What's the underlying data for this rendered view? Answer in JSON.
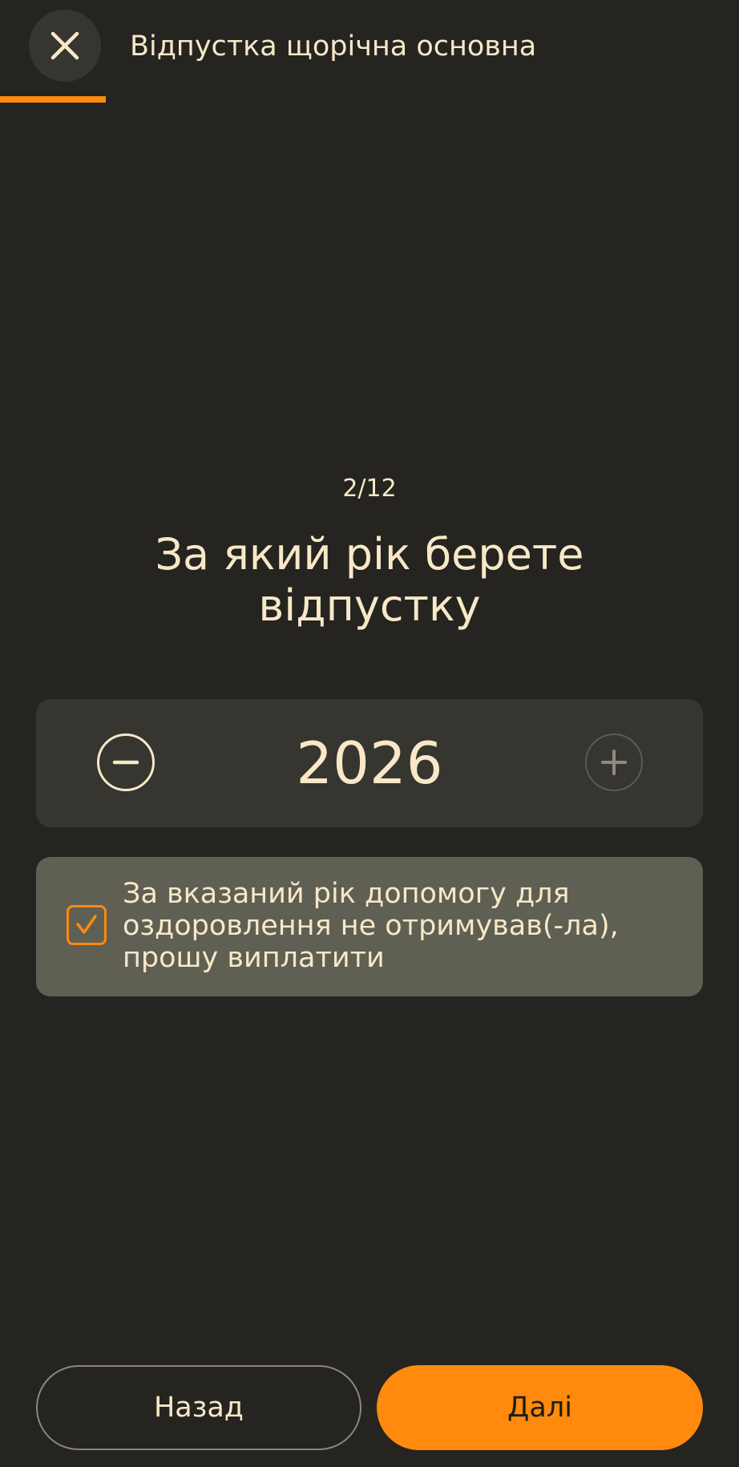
{
  "header": {
    "title": "Відпустка щорічна основна",
    "close_icon": "close-icon"
  },
  "progress": {
    "current": 2,
    "total": 12,
    "fraction": 0.1429,
    "color": "#FF8A0D"
  },
  "step": {
    "counter": "2/12",
    "question": "За який рік берете відпустку"
  },
  "year_stepper": {
    "value": "2026",
    "minus_icon": "minus-icon",
    "plus_icon": "plus-icon"
  },
  "health_aid": {
    "checked": true,
    "label": "За вказаний рік допомогу для оздоровлення не отримував(-ла), прошу виплатити"
  },
  "footer": {
    "back_label": "Назад",
    "next_label": "Далі"
  },
  "colors": {
    "background": "#252420",
    "surface": "#363530",
    "card": "#5F5F54",
    "text": "#F8E8C8",
    "accent": "#FF8A0D"
  }
}
